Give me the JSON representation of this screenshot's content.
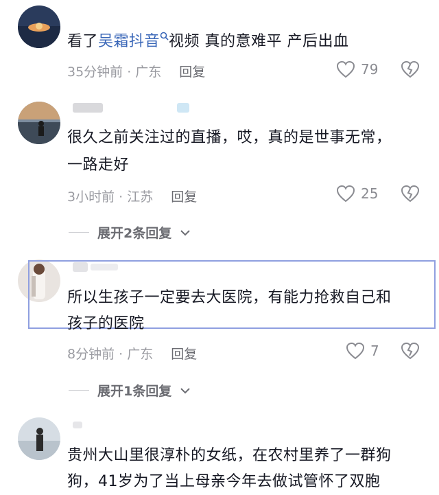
{
  "comments": [
    {
      "text_before": "看了",
      "link": "吴霜抖音",
      "text_after": "视频  真的意难平  产后出血",
      "meta": "35分钟前 · 广东",
      "reply": "回复",
      "likes": "79",
      "icons": [
        "heart-outline-icon",
        "broken-heart-icon",
        "search-icon"
      ]
    },
    {
      "line1": "很久之前关注过的直播，哎，真的是世事无常，",
      "line2": "一路走好",
      "meta": "3小时前 · 江苏",
      "reply": "回复",
      "likes": "25",
      "expand": "展开2条回复"
    },
    {
      "line1": "所以生孩子一定要去大医院，有能力抢救自己和",
      "line2": "孩子的医院",
      "meta": "8分钟前 · 广东",
      "reply": "回复",
      "likes": "7",
      "expand": "展开1条回复"
    },
    {
      "line1": "贵州大山里很淳朴的女纸，在农村里养了一群狗",
      "line2": "狗，41岁为了当上母亲今年去做试管怀了双胞"
    }
  ],
  "colors": {
    "link": "#3a67b8",
    "meta": "#9a9ba1",
    "highlight_border": "#8f9fe0"
  }
}
